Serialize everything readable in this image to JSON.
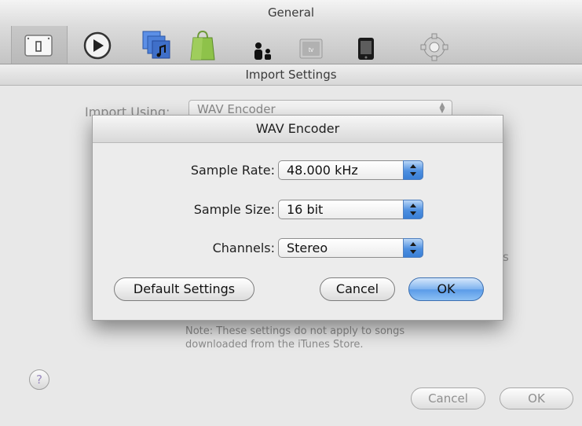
{
  "window": {
    "title": "General",
    "toolbar_icons": [
      "general-icon",
      "playback-icon",
      "sharing-icon",
      "store-icon",
      "parental-icon",
      "apple-tv-icon",
      "devices-icon",
      "advanced-gear-icon"
    ],
    "toolbar_icon_text": {
      "apple_tv": "tv"
    }
  },
  "sheet": {
    "title": "Import Settings",
    "import_using_label": "Import Using:",
    "import_using_value": "WAV Encoder",
    "partial_right_text": "s",
    "note": "Note: These settings do not apply to songs downloaded from the iTunes Store.",
    "help_label": "?",
    "cancel_label": "Cancel",
    "ok_label": "OK"
  },
  "dialog": {
    "title": "WAV Encoder",
    "fields": [
      {
        "label": "Sample Rate:",
        "value": "48.000 kHz"
      },
      {
        "label": "Sample Size:",
        "value": "16 bit"
      },
      {
        "label": "Channels:",
        "value": "Stereo"
      }
    ],
    "default_settings_label": "Default Settings",
    "cancel_label": "Cancel",
    "ok_label": "OK"
  },
  "colors": {
    "accent_blue": "#5a9be8",
    "window_bg": "#e8e8e8"
  }
}
